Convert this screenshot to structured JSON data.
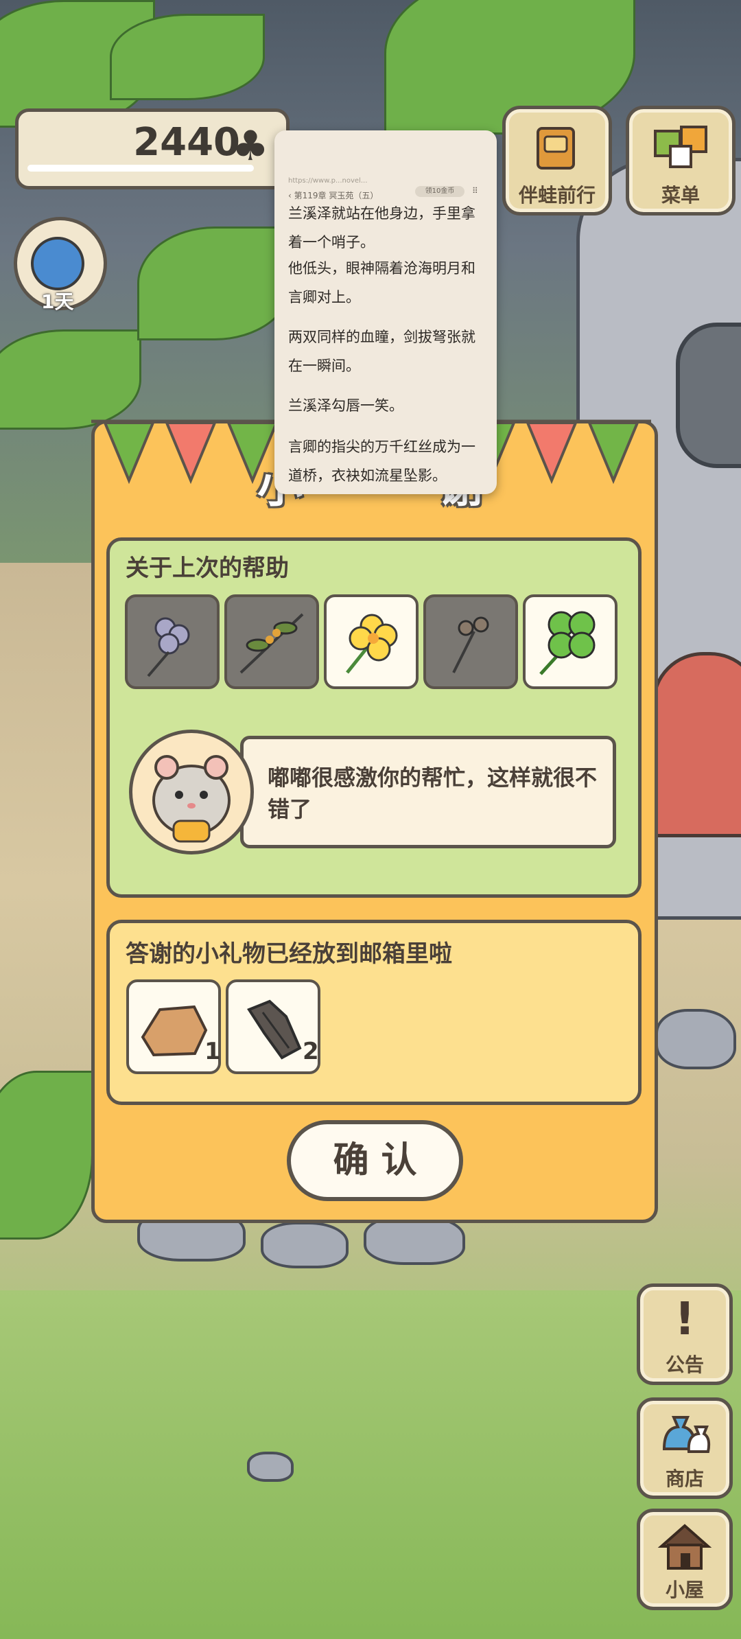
{
  "hud": {
    "clover_count": "2440",
    "clover_icon": "♣",
    "day_label": "1天"
  },
  "top_buttons": [
    {
      "label": "伴蛙前行",
      "icon": "book-icon"
    },
    {
      "label": "菜单",
      "icon": "menu-cards-icon"
    }
  ],
  "side_buttons": [
    {
      "label": "公告",
      "icon": "exclamation-icon"
    },
    {
      "label": "商店",
      "icon": "bag-icon"
    },
    {
      "label": "小屋",
      "icon": "house-icon"
    }
  ],
  "dialog": {
    "title": "小⋯⋯⋯谢",
    "help_heading": "关于上次的帮助",
    "help_items": [
      {
        "icon": "lilac-flower-icon",
        "state": "dim"
      },
      {
        "icon": "osmanthus-branch-icon",
        "state": "dim"
      },
      {
        "icon": "yellow-flower-icon",
        "state": "active"
      },
      {
        "icon": "seed-pods-icon",
        "state": "dim"
      },
      {
        "icon": "four-leaf-clover-icon",
        "state": "active"
      }
    ],
    "speech": "嘟嘟很感激你的帮忙，这样就很不错了",
    "gift_heading": "答谢的小礼物已经放到邮箱里啦",
    "gifts": [
      {
        "icon": "stone-icon",
        "count": "1"
      },
      {
        "icon": "wood-icon",
        "count": "2"
      }
    ],
    "confirm_label": "确 认"
  },
  "reader_overlay": {
    "url": "https://www.p...novel...",
    "chapter": "‹ 第119章 冥玉苑（五）",
    "pill": "领10金币",
    "menu_glyph": "⠿",
    "paragraphs": [
      "兰溪泽就站在他身边，手里拿着一个哨子。",
      "他低头，眼神隔着沧海明月和言卿对上。",
      "两双同样的血瞳，剑拔弩张就在一瞬间。",
      "兰溪泽勾唇一笑。",
      "言卿的指尖的万千红丝成为一道桥，衣袂如流星坠影。"
    ]
  },
  "colors": {
    "dialog_bg": "#fcc35a",
    "help_panel_bg": "#cfe59a",
    "gift_panel_bg": "#fde08f",
    "outline": "#5b544b"
  }
}
